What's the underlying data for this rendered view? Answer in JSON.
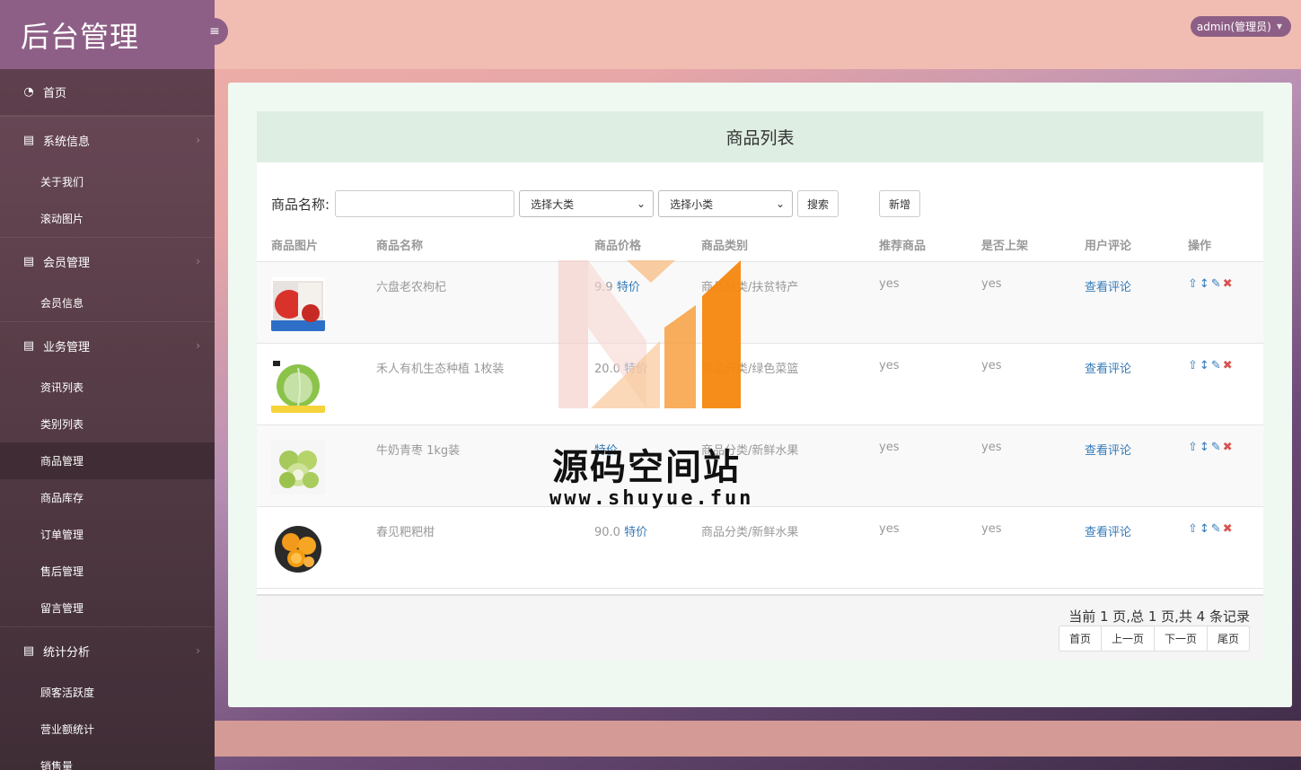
{
  "sidebar": {
    "brand": "后台管理",
    "top_item": "首页",
    "groups": [
      {
        "label": "系统信息",
        "items": [
          "关于我们",
          "滚动图片"
        ]
      },
      {
        "label": "会员管理",
        "items": [
          "会员信息"
        ]
      },
      {
        "label": "业务管理",
        "items": [
          "资讯列表",
          "类别列表",
          "商品管理",
          "商品库存",
          "订单管理",
          "售后管理",
          "留言管理"
        ]
      },
      {
        "label": "统计分析",
        "items": [
          "顾客活跃度",
          "营业额统计",
          "销售量"
        ]
      }
    ],
    "active_item": "商品管理"
  },
  "header": {
    "user_label": "admin(管理员)"
  },
  "panel": {
    "title": "商品列表",
    "search": {
      "label": "商品名称:",
      "value": "",
      "category_select": "选择大类",
      "subcategory_select": "选择小类",
      "search_button": "搜索",
      "add_button": "新增"
    },
    "columns": [
      "商品图片",
      "商品名称",
      "商品价格",
      "商品类别",
      "推荐商品",
      "是否上架",
      "用户评论",
      "操作"
    ],
    "rows": [
      {
        "name": "六盘老农枸杞",
        "price": "9.9",
        "price_tag": "特价",
        "category": "商品分类/扶贫特产",
        "recommend": "yes",
        "onsale": "yes",
        "comment_link": "查看评论"
      },
      {
        "name": "禾人有机生态种植 1枚装",
        "price": "20.0",
        "price_tag": "特价",
        "category": "商品分类/绿色菜篮",
        "recommend": "yes",
        "onsale": "yes",
        "comment_link": "查看评论"
      },
      {
        "name": "牛奶青枣 1kg装",
        "price": "",
        "price_tag": "特价",
        "category": "商品分类/新鲜水果",
        "recommend": "yes",
        "onsale": "yes",
        "comment_link": "查看评论"
      },
      {
        "name": "春见粑粑柑",
        "price": "90.0",
        "price_tag": "特价",
        "category": "商品分类/新鲜水果",
        "recommend": "yes",
        "onsale": "yes",
        "comment_link": "查看评论"
      }
    ],
    "pager": {
      "info": "当前 1 页,总 1 页,共 4 条记录",
      "first": "首页",
      "prev": "上一页",
      "next": "下一页",
      "last": "尾页"
    }
  },
  "watermark": {
    "text": "源码空间站",
    "url": "www.shuyue.fun"
  },
  "colors": {
    "sidebar_brand": "#8e5f86",
    "header": "#f1bdb3",
    "link": "#337ab7",
    "delete": "#d9534f"
  }
}
